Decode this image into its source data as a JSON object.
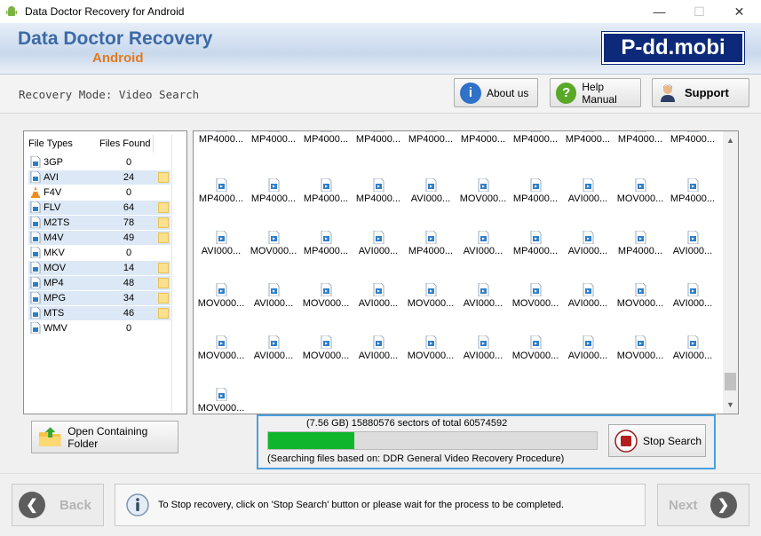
{
  "window": {
    "title": "Data Doctor Recovery for Android",
    "minimize": "—",
    "maximize": "☐",
    "close": "✕"
  },
  "banner": {
    "title": "Data Doctor Recovery",
    "subtitle": "Android",
    "site": "P-dd.mobi"
  },
  "mode": {
    "text": "Recovery Mode: Video Search"
  },
  "toolbar": {
    "about": "About us",
    "help": "Help Manual",
    "support": "Support"
  },
  "filetypes": {
    "col_type": "File Types",
    "col_count": "Files Found",
    "rows": [
      {
        "name": "3GP",
        "count": "0",
        "selected": false,
        "folder": false
      },
      {
        "name": "AVI",
        "count": "24",
        "selected": true,
        "folder": true
      },
      {
        "name": "F4V",
        "count": "0",
        "selected": false,
        "folder": false
      },
      {
        "name": "FLV",
        "count": "64",
        "selected": true,
        "folder": true
      },
      {
        "name": "M2TS",
        "count": "78",
        "selected": true,
        "folder": true
      },
      {
        "name": "M4V",
        "count": "49",
        "selected": true,
        "folder": true
      },
      {
        "name": "MKV",
        "count": "0",
        "selected": false,
        "folder": false
      },
      {
        "name": "MOV",
        "count": "14",
        "selected": true,
        "folder": true
      },
      {
        "name": "MP4",
        "count": "48",
        "selected": true,
        "folder": true
      },
      {
        "name": "MPG",
        "count": "34",
        "selected": true,
        "folder": true
      },
      {
        "name": "MTS",
        "count": "46",
        "selected": true,
        "folder": true
      },
      {
        "name": "WMV",
        "count": "0",
        "selected": false,
        "folder": false
      }
    ]
  },
  "files": [
    [
      "MP4000...",
      "MP4000...",
      "MP4000...",
      "MP4000...",
      "MP4000...",
      "MP4000...",
      "MP4000...",
      "MP4000...",
      "MP4000...",
      "MP4000..."
    ],
    [
      "MP4000...",
      "MP4000...",
      "MP4000...",
      "MP4000...",
      "AVI000...",
      "MOV000...",
      "MP4000...",
      "AVI000...",
      "MOV000...",
      "MP4000..."
    ],
    [
      "AVI000...",
      "MOV000...",
      "MP4000...",
      "AVI000...",
      "MP4000...",
      "AVI000...",
      "MP4000...",
      "AVI000...",
      "MP4000...",
      "AVI000..."
    ],
    [
      "MOV000...",
      "AVI000...",
      "MOV000...",
      "AVI000...",
      "MOV000...",
      "AVI000...",
      "MOV000...",
      "AVI000...",
      "MOV000...",
      "AVI000..."
    ],
    [
      "MOV000...",
      "AVI000...",
      "MOV000...",
      "AVI000...",
      "MOV000...",
      "AVI000...",
      "MOV000...",
      "AVI000...",
      "MOV000...",
      "AVI000..."
    ],
    [
      "MOV000..."
    ]
  ],
  "open_folder": {
    "label": "Open Containing Folder"
  },
  "progress": {
    "status": "(7.56 GB) 15880576  sectors  of  total 60574592",
    "fraction": 0.262,
    "basis": "(Searching files based on:  DDR General Video Recovery Procedure)",
    "stop_label": "Stop Search"
  },
  "bottom": {
    "back": "Back",
    "next": "Next",
    "info": "To Stop recovery, click on 'Stop Search' button or please wait for the process to be completed."
  },
  "colors": {
    "progress_fill": "#0fb62c",
    "accent": "#4a9fe0",
    "brand": "#3c6aa6",
    "brand_sub": "#e07a1f"
  }
}
